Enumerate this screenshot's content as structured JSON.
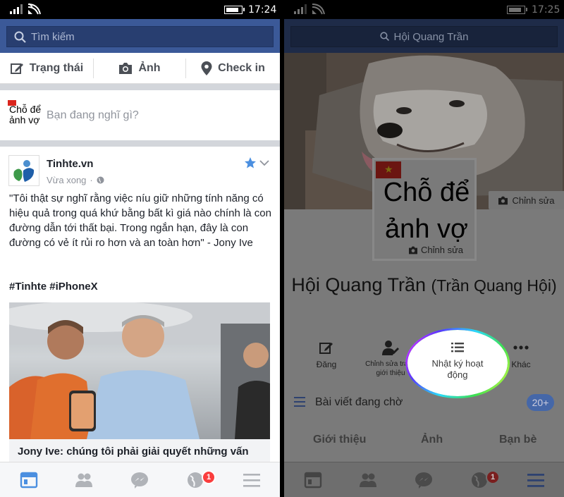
{
  "left": {
    "status": {
      "time": "17:24"
    },
    "search": {
      "placeholder": "Tìm kiếm"
    },
    "composer": {
      "status_label": "Trạng thái",
      "photo_label": "Ảnh",
      "checkin_label": "Check in"
    },
    "whats_on_mind": {
      "avatar_text": "Chỗ để ảnh vợ",
      "prompt": "Bạn đang nghĩ gì?"
    },
    "post": {
      "page_name": "Tinhte.vn",
      "time": "Vừa xong",
      "body": "\"Tôi thật sự nghĩ rằng việc níu giữ những tính năng có hiệu quả trong quá khứ bằng bất kì giá nào chính là con đường dẫn tới thất bại. Trong ngắn hạn, đây là con đường có vẻ ít rủi ro hơn và an toàn hơn\" - Jony Ive",
      "hashtags": "#Tinhte #iPhoneX",
      "link_title": "Jony Ive: chúng tôi phải giải quyết những vấn"
    },
    "bottom_nav": {
      "notifications_badge": "1"
    }
  },
  "right": {
    "status": {
      "time": "17:25"
    },
    "search": {
      "value": "Hội Quang Trần"
    },
    "avatar_text_line1": "Chỗ để",
    "avatar_text_line2": "ảnh vợ",
    "avatar_edit": "Chỉnh sửa",
    "cover_edit": "Chỉnh sửa",
    "profile_name": "Hội Quang Trần",
    "profile_alt_name": "(Trần Quang Hội)",
    "actions": {
      "post": "Đăng",
      "edit_intro": "Chỉnh sửa trang giới thiệu",
      "activity_log": "Nhật ký hoạt động",
      "more": "Khác"
    },
    "pending": {
      "label": "Bài viết đang chờ",
      "count": "20+"
    },
    "tabs": {
      "about": "Giới thiệu",
      "photos": "Ảnh",
      "friends": "Bạn bè"
    },
    "bottom_nav": {
      "notifications_badge": "1"
    }
  },
  "colors": {
    "fb_blue": "#3b5998",
    "badge_red": "#fa3e3e",
    "active_blue": "#4b8fe0"
  }
}
